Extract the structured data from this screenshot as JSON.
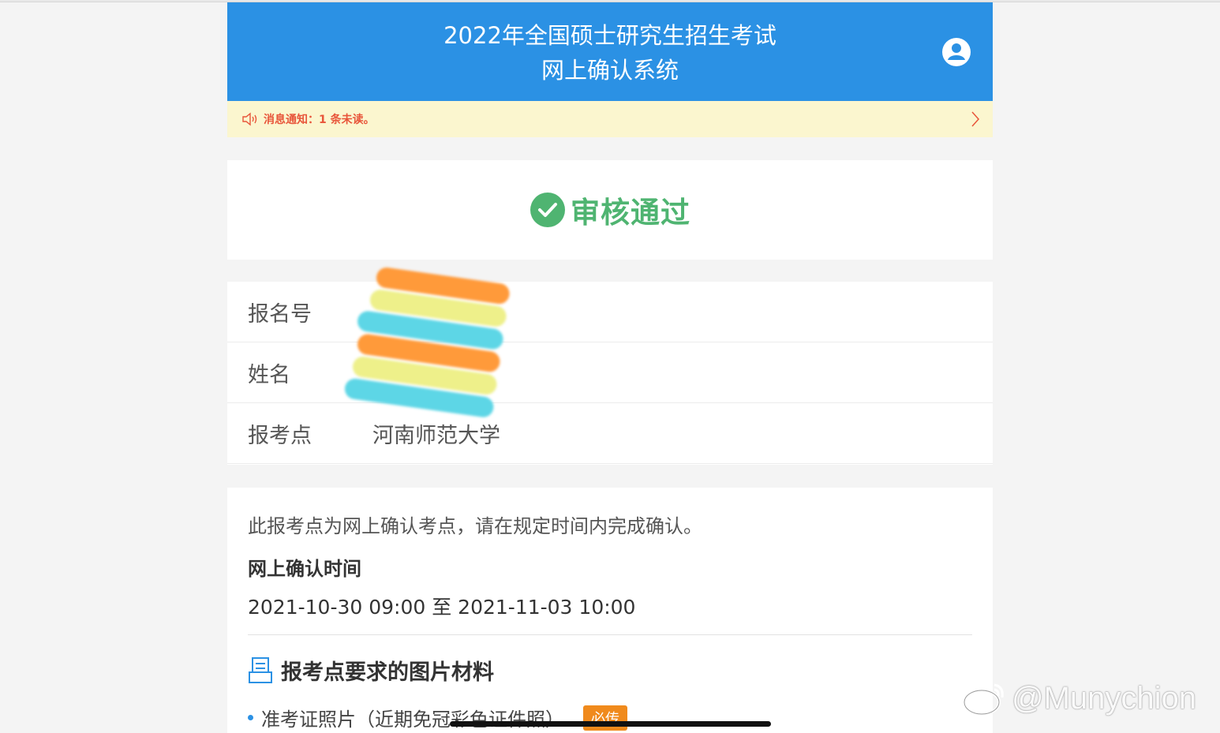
{
  "header": {
    "title_line1": "2022年全国硕士研究生招生考试",
    "title_line2": "网上确认系统",
    "user_icon": "user-circle-icon",
    "color": "#2b91e4"
  },
  "notice": {
    "text": "消息通知：1 条未读。",
    "icon": "speaker-icon"
  },
  "status": {
    "text": "审核通过",
    "icon": "check-circle-icon",
    "color": "#4fb471"
  },
  "info": {
    "rows": [
      {
        "label": "报名号",
        "value": ""
      },
      {
        "label": "姓名",
        "value": ""
      },
      {
        "label": "报考点",
        "value": "河南师范大学"
      }
    ]
  },
  "details": {
    "note": "此报考点为网上确认考点，请在规定时间内完成确认。",
    "time_heading": "网上确认时间",
    "time_range": "2021-10-30 09:00 至 2021-11-03 10:00",
    "materials_heading": "报考点要求的图片材料",
    "materials": [
      {
        "label": "准考证照片（近期免冠彩色证件照）",
        "badge": "必传"
      }
    ]
  },
  "watermark": {
    "text": "@Munychion",
    "icon": "weibo-icon"
  }
}
